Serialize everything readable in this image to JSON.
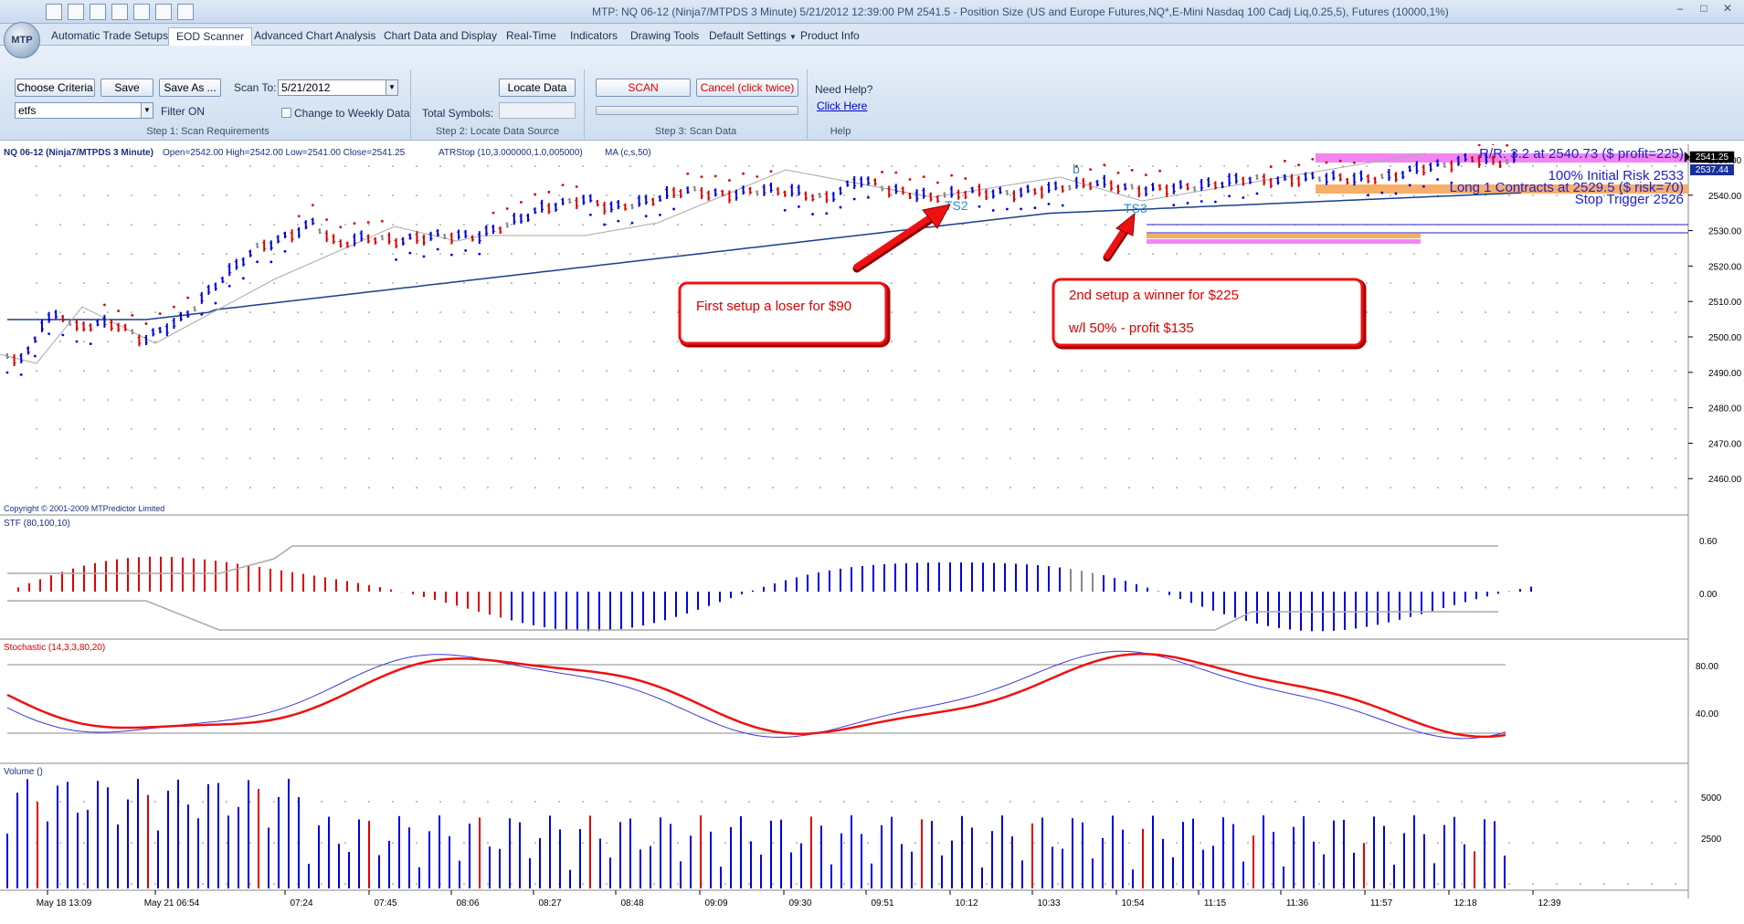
{
  "window": {
    "title": "MTP: NQ 06-12 (Ninja7/MTPDS 3 Minute) 5/21/2012 12:39:00 PM 2541.5 - Position Size (US and Europe Futures,NQ*,E-Mini Nasdaq 100 Cadj Liq,0.25,5), Futures (10000,1%)",
    "logo": "MTP"
  },
  "tabs": [
    "Automatic Trade Setups",
    "EOD Scanner",
    "Advanced Chart Analysis",
    "Chart Data and Display",
    "Real-Time",
    "Indicators",
    "Drawing Tools",
    "Default Settings",
    "Product Info"
  ],
  "ribbon": {
    "choose_criteria": "Choose Criteria",
    "save": "Save",
    "save_as": "Save As ...",
    "scan_to_label": "Scan To:",
    "scan_to_value": "5/21/2012",
    "criteria_value": "etfs",
    "filter": "Filter ON",
    "weekly": "Change to Weekly Data",
    "step1": "Step 1: Scan Requirements",
    "locate": "Locate Data",
    "total_symbols": "Total Symbols:",
    "step2": "Step 2: Locate Data Source",
    "scan": "SCAN",
    "cancel": "Cancel (click twice)",
    "step3": "Step 3: Scan Data",
    "need_help": "Need Help?",
    "click_here": "Click Here",
    "help": "Help"
  },
  "chart": {
    "header": "NQ 06-12 (Ninja7/MTPDS 3 Minute)",
    "ohlc": "Open=2542.00  High=2542.00  Low=2541.00  Close=2541.25",
    "atr": "ATRStop (10,3.000000,1.0,005000)",
    "ma": "MA (c,s,50)",
    "copyright": "Copyright © 2001-2009 MTPredictor Limited",
    "price_ticks": [
      "2550.00",
      "2540.00",
      "2530.00",
      "2520.00",
      "2510.00",
      "2500.00",
      "2490.00",
      "2480.00",
      "2470.00",
      "2460.00"
    ],
    "price_tag": "2541.25",
    "stop_tag": "2537.44",
    "rr": "R/R: 3.2 at 2540.73 ($ profit=225)",
    "initial_risk": "100% Initial Risk 2533",
    "long": "Long 1 Contracts at 2529.5 ($ risk=70)",
    "stop_trigger": "Stop Trigger 2526",
    "ts2": "TS2",
    "ts3": "TS3",
    "b": "b",
    "note1": "First setup a loser for $90",
    "note2_line1": "2nd setup a winner for $225",
    "note2_line2": "w/l 50%     -    profit $135",
    "stf_label": "STF (80,100,10)",
    "stf_ticks": [
      "0.60",
      "0.00"
    ],
    "stoch_label": "Stochastic (14,3,3,80,20)",
    "stoch_ticks": [
      "80.00",
      "40.00"
    ],
    "volume_label": "Volume ()",
    "volume_ticks": [
      "5000",
      "2500"
    ],
    "time_ticks": [
      "May 18 13:09",
      "May 21 06:54",
      "07:24",
      "07:45",
      "08:06",
      "08:27",
      "08:48",
      "09:09",
      "09:30",
      "09:51",
      "10:12",
      "10:33",
      "10:54",
      "11:15",
      "11:36",
      "11:57",
      "12:18",
      "12:39"
    ],
    "colors": {
      "up": "#0000dd",
      "down": "#dd0000",
      "ma": "#1a3f8a",
      "note_border": "#e00000"
    }
  }
}
